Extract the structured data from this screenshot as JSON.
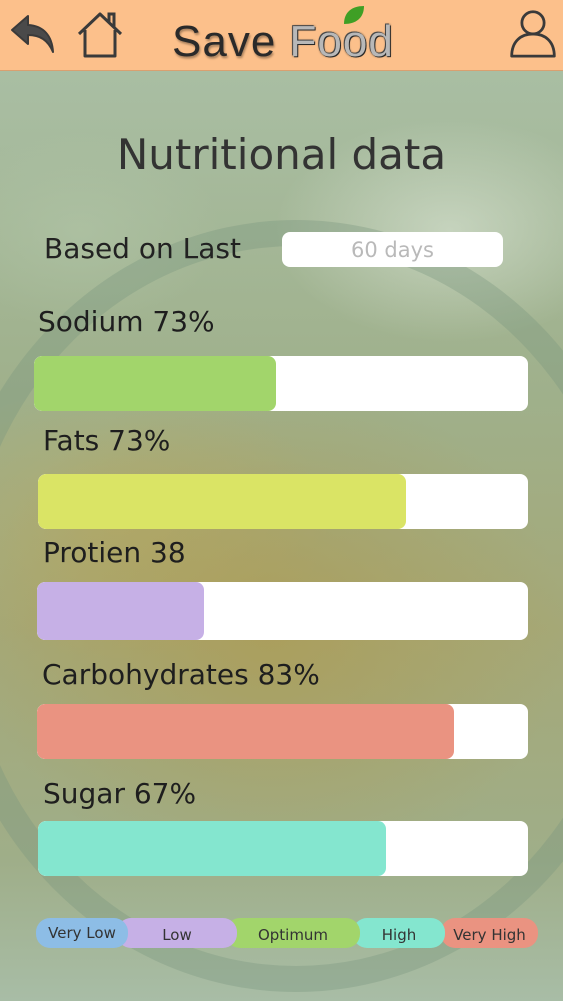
{
  "app": {
    "brand_word1": "Save",
    "brand_word2": "Food"
  },
  "page": {
    "title": "Nutritional data",
    "range_label": "Based on Last",
    "range_value": "60 days"
  },
  "metrics": [
    {
      "label": "Sodium 73%",
      "fill_fraction": 0.49,
      "color": "#a2d56b"
    },
    {
      "label": "Fats 73%",
      "fill_fraction": 0.75,
      "color": "#dae465"
    },
    {
      "label": "Protien 38",
      "fill_fraction": 0.34,
      "color": "#c6b0e6"
    },
    {
      "label": "Carbohydrates 83%",
      "fill_fraction": 0.85,
      "color": "#ea9381"
    },
    {
      "label": "Sugar 67%",
      "fill_fraction": 0.71,
      "color": "#84e6cf"
    }
  ],
  "legend": [
    {
      "label": "Very Low",
      "color": "#8dbde6"
    },
    {
      "label": "Low",
      "color": "#c6b0e6"
    },
    {
      "label": "Optimum",
      "color": "#a2d56b"
    },
    {
      "label": "High",
      "color": "#84e6cf"
    },
    {
      "label": "Very High",
      "color": "#ea9381"
    }
  ],
  "icons": {
    "back": "back-arrow-icon",
    "home": "home-icon",
    "profile": "profile-icon",
    "leaf": "leaf-icon"
  },
  "colors": {
    "topbar": "#fcc08b"
  }
}
